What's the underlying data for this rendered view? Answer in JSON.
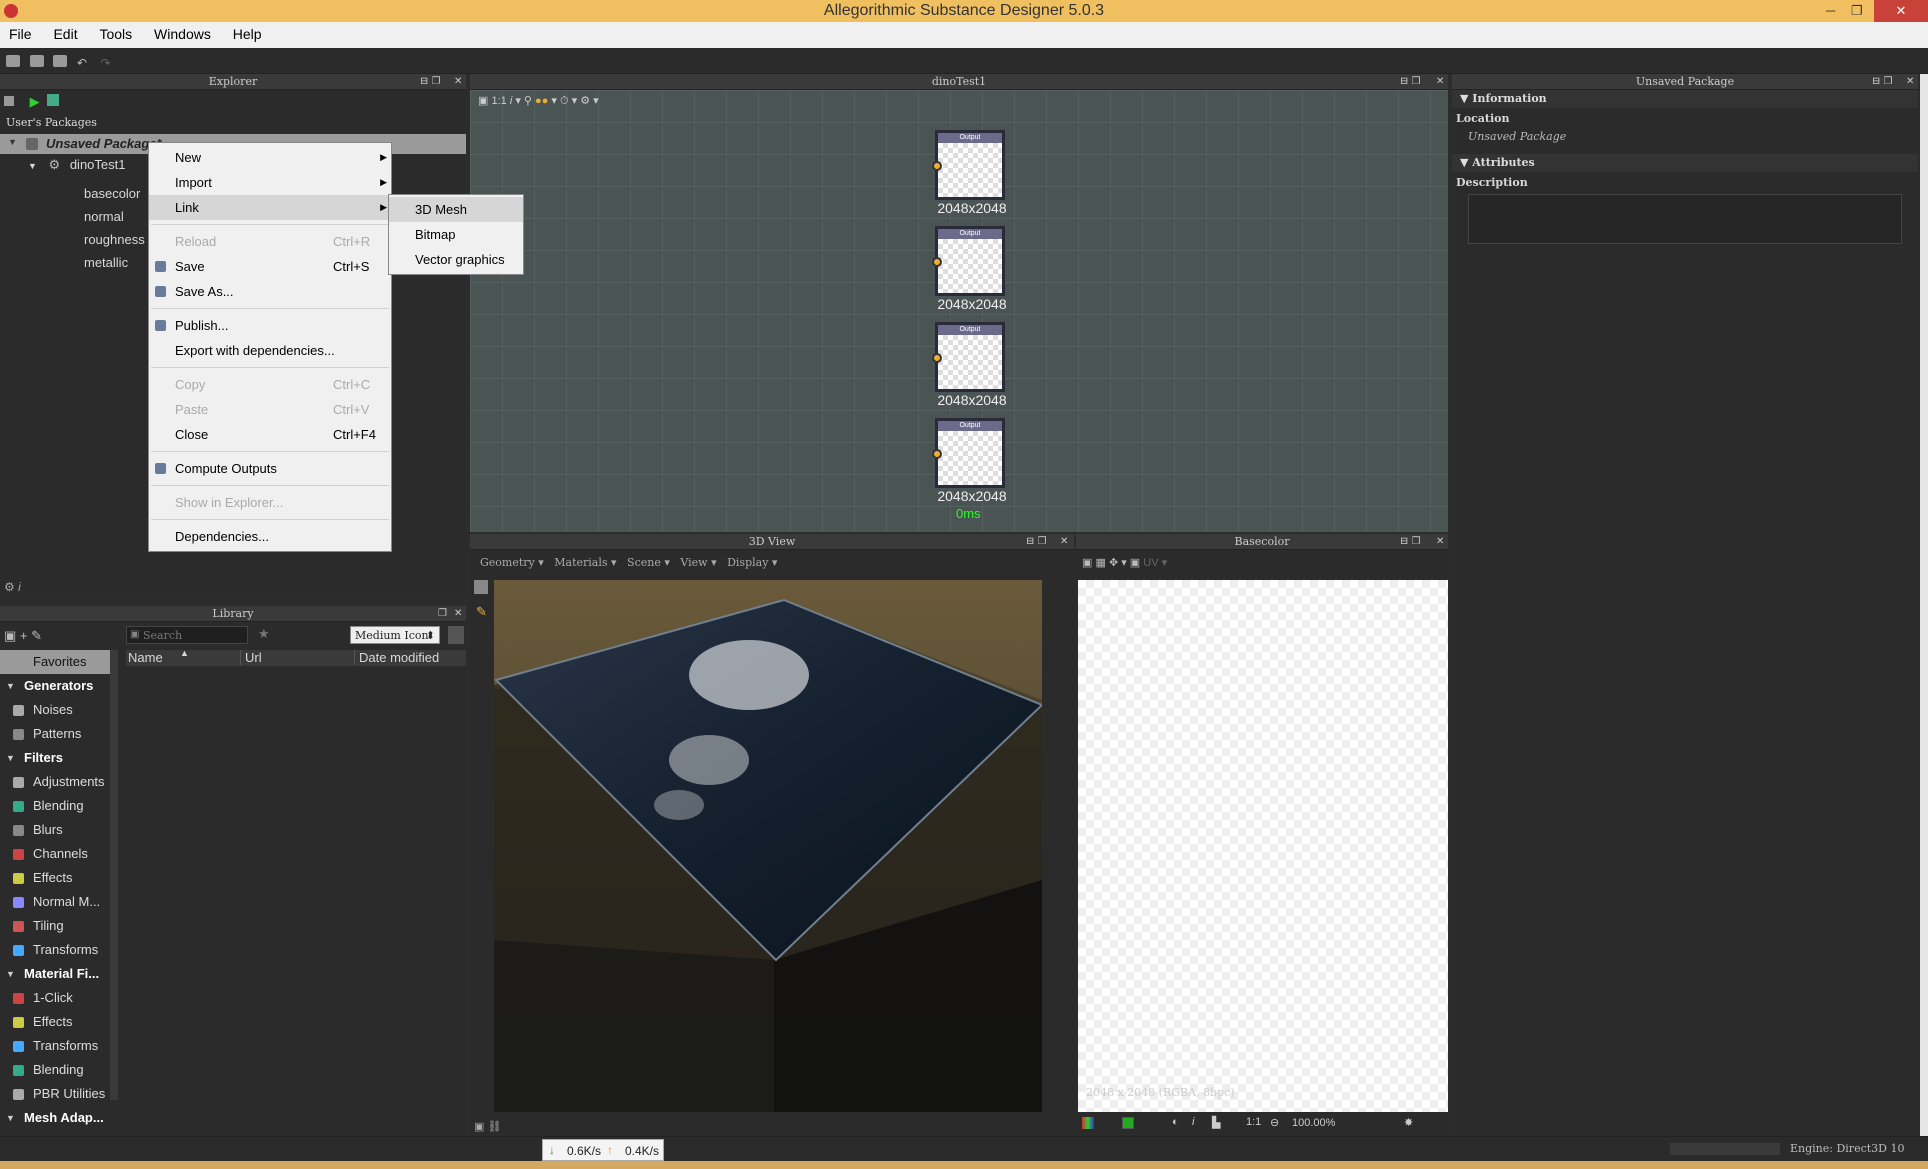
{
  "window": {
    "title": "Allegorithmic Substance Designer 5.0.3"
  },
  "menu": [
    "File",
    "Edit",
    "Tools",
    "Windows",
    "Help"
  ],
  "explorer": {
    "title": "Explorer",
    "root": "User's Packages",
    "package": "Unsaved Package*",
    "graph": "dinoTest1",
    "outputs": [
      "basecolor",
      "normal",
      "roughness",
      "metallic"
    ]
  },
  "context_menu": {
    "items": [
      {
        "label": "New",
        "shortcut": "",
        "submenu": true,
        "disabled": false
      },
      {
        "label": "Import",
        "shortcut": "",
        "submenu": true,
        "disabled": false
      },
      {
        "label": "Link",
        "shortcut": "",
        "submenu": true,
        "disabled": false
      },
      {
        "label": "Reload",
        "shortcut": "Ctrl+R",
        "submenu": false,
        "disabled": true
      },
      {
        "label": "Save",
        "shortcut": "Ctrl+S",
        "submenu": false,
        "disabled": false
      },
      {
        "label": "Save As...",
        "shortcut": "",
        "submenu": false,
        "disabled": false
      },
      {
        "label": "Publish...",
        "shortcut": "",
        "submenu": false,
        "disabled": false
      },
      {
        "label": "Export with dependencies...",
        "shortcut": "",
        "submenu": false,
        "disabled": false
      },
      {
        "label": "Copy",
        "shortcut": "Ctrl+C",
        "submenu": false,
        "disabled": true
      },
      {
        "label": "Paste",
        "shortcut": "Ctrl+V",
        "submenu": false,
        "disabled": true
      },
      {
        "label": "Close",
        "shortcut": "Ctrl+F4",
        "submenu": false,
        "disabled": false
      },
      {
        "label": "Compute Outputs",
        "shortcut": "",
        "submenu": false,
        "disabled": false
      },
      {
        "label": "Show in Explorer...",
        "shortcut": "",
        "submenu": false,
        "disabled": true
      },
      {
        "label": "Dependencies...",
        "shortcut": "",
        "submenu": false,
        "disabled": false
      }
    ],
    "link_submenu": [
      "3D Mesh",
      "Bitmap",
      "Vector graphics"
    ]
  },
  "graph": {
    "title": "dinoTest1",
    "zoom": "1:1",
    "node_label": "Output",
    "node_resolution": "2048x2048",
    "timing": "0ms"
  },
  "properties": {
    "title": "Unsaved Package",
    "information": "Information",
    "location_label": "Location",
    "location_value": "Unsaved Package",
    "attributes": "Attributes",
    "description_label": "Description"
  },
  "library": {
    "title": "Library",
    "search_placeholder": "Search",
    "view_mode": "Medium Icon",
    "columns": [
      "Name",
      "Url",
      "Date modified"
    ],
    "tree": [
      {
        "type": "item",
        "label": "Favorites",
        "icon": "#999"
      },
      {
        "type": "cat",
        "label": "Generators"
      },
      {
        "type": "item",
        "label": "Noises",
        "icon": "#aaa"
      },
      {
        "type": "item",
        "label": "Patterns",
        "icon": "#888"
      },
      {
        "type": "cat",
        "label": "Filters"
      },
      {
        "type": "item",
        "label": "Adjustments",
        "icon": "#aaa"
      },
      {
        "type": "item",
        "label": "Blending",
        "icon": "#3a8"
      },
      {
        "type": "item",
        "label": "Blurs",
        "icon": "#888"
      },
      {
        "type": "item",
        "label": "Channels",
        "icon": "#c44"
      },
      {
        "type": "item",
        "label": "Effects",
        "icon": "#cc4"
      },
      {
        "type": "item",
        "label": "Normal M...",
        "icon": "#88f"
      },
      {
        "type": "item",
        "label": "Tiling",
        "icon": "#c55"
      },
      {
        "type": "item",
        "label": "Transforms",
        "icon": "#4af"
      },
      {
        "type": "cat",
        "label": "Material Fi..."
      },
      {
        "type": "item",
        "label": "1-Click",
        "icon": "#c44"
      },
      {
        "type": "item",
        "label": "Effects",
        "icon": "#cc4"
      },
      {
        "type": "item",
        "label": "Transforms",
        "icon": "#4af"
      },
      {
        "type": "item",
        "label": "Blending",
        "icon": "#3a8"
      },
      {
        "type": "item",
        "label": "PBR Utilities",
        "icon": "#aaa"
      },
      {
        "type": "cat",
        "label": "Mesh Adap..."
      }
    ]
  },
  "view3d": {
    "title": "3D View",
    "menus": [
      "Geometry",
      "Materials",
      "Scene",
      "View",
      "Display"
    ]
  },
  "view2d": {
    "title": "Basecolor",
    "channel": "UV",
    "info": "2048 x 2048 (RGBA, 8bpc)",
    "zoom": "100.00%",
    "ratio": "1:1"
  },
  "status": {
    "engine": "Engine: Direct3D 10",
    "download": "0.6K/s",
    "upload": "0.4K/s"
  }
}
